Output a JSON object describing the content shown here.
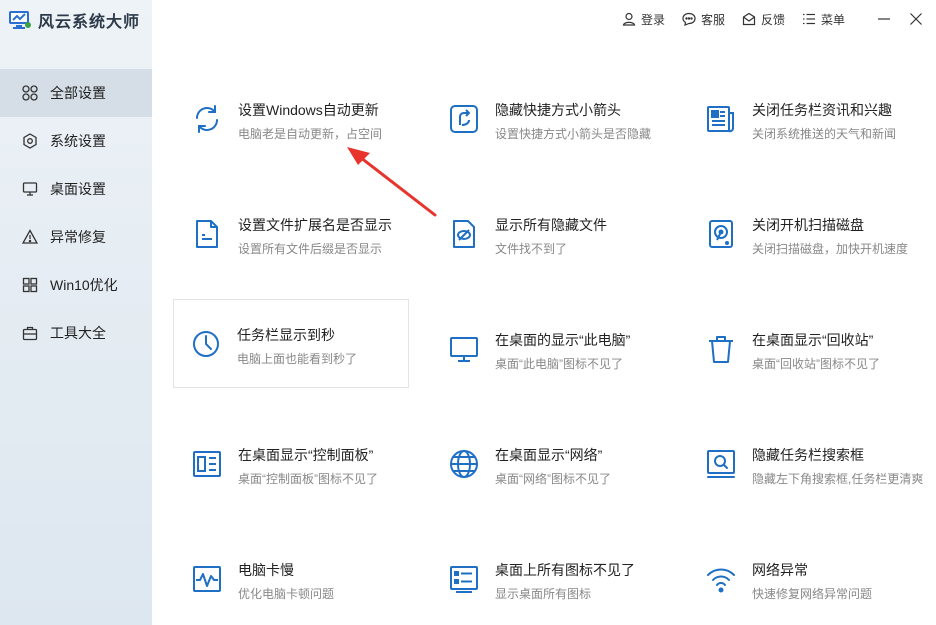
{
  "app": {
    "title": "风云系统大师"
  },
  "topbar": {
    "login": "登录",
    "service": "客服",
    "feedback": "反馈",
    "menu": "菜单"
  },
  "sidebar": {
    "items": [
      {
        "label": "全部设置",
        "icon": "grid-icon"
      },
      {
        "label": "系统设置",
        "icon": "gear-icon"
      },
      {
        "label": "桌面设置",
        "icon": "monitor-icon"
      },
      {
        "label": "异常修复",
        "icon": "warning-icon"
      },
      {
        "label": "Win10优化",
        "icon": "windows-icon"
      },
      {
        "label": "工具大全",
        "icon": "toolbox-icon"
      }
    ]
  },
  "cards": [
    {
      "title": "设置Windows自动更新",
      "desc": "电脑老是自动更新，占空间",
      "icon": "refresh-icon"
    },
    {
      "title": "隐藏快捷方式小箭头",
      "desc": "设置快捷方式小箭头是否隐藏",
      "icon": "shortcut-arrow-icon"
    },
    {
      "title": "关闭任务栏资讯和兴趣",
      "desc": "关闭系统推送的天气和新闻",
      "icon": "news-icon"
    },
    {
      "title": "设置文件扩展名是否显示",
      "desc": "设置所有文件后缀是否显示",
      "icon": "file-icon"
    },
    {
      "title": "显示所有隐藏文件",
      "desc": "文件找不到了",
      "icon": "hidden-file-icon"
    },
    {
      "title": "关闭开机扫描磁盘",
      "desc": "关闭扫描磁盘，加快开机速度",
      "icon": "disk-icon"
    },
    {
      "title": "任务栏显示到秒",
      "desc": "电脑上面也能看到秒了",
      "icon": "clock-icon"
    },
    {
      "title": "在桌面的显示“此电脑”",
      "desc": "桌面“此电脑”图标不见了",
      "icon": "computer-icon"
    },
    {
      "title": "在桌面显示“回收站”",
      "desc": "桌面“回收站”图标不见了",
      "icon": "trash-icon"
    },
    {
      "title": "在桌面显示“控制面板”",
      "desc": "桌面“控制面板”图标不见了",
      "icon": "control-panel-icon"
    },
    {
      "title": "在桌面显示“网络”",
      "desc": "桌面“网络”图标不见了",
      "icon": "globe-icon"
    },
    {
      "title": "隐藏任务栏搜索框",
      "desc": "隐藏左下角搜索框,任务栏更清爽",
      "icon": "search-box-icon"
    },
    {
      "title": "电脑卡慢",
      "desc": "优化电脑卡顿问题",
      "icon": "pulse-icon"
    },
    {
      "title": "桌面上所有图标不见了",
      "desc": "显示桌面所有图标",
      "icon": "desktop-icons-icon"
    },
    {
      "title": "网络异常",
      "desc": "快速修复网络异常问题",
      "icon": "wifi-icon"
    }
  ],
  "colors": {
    "accent": "#1f6fc5",
    "arrow": "#e8342d",
    "sidebar_active": "#d5dee7"
  }
}
